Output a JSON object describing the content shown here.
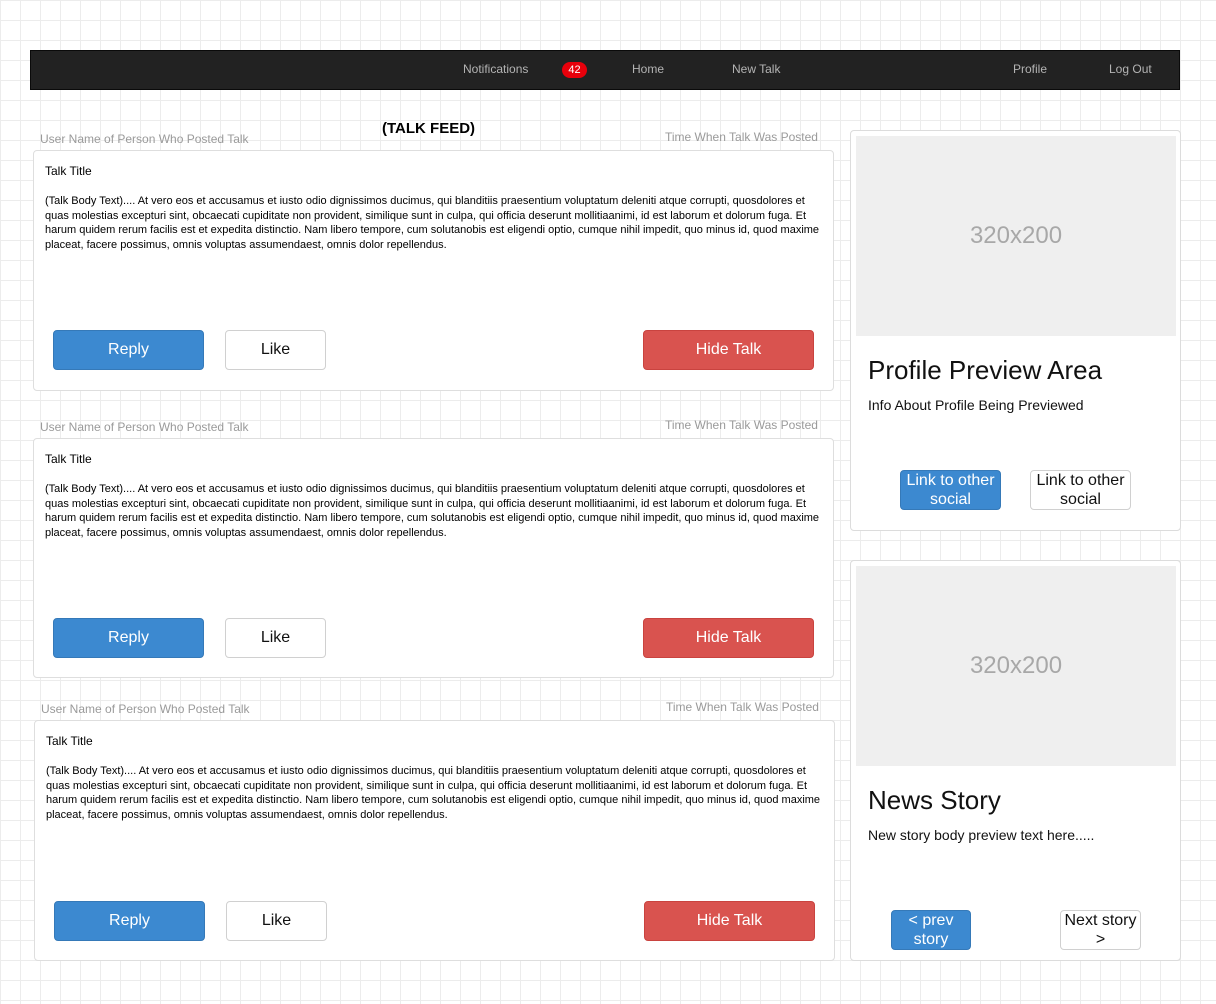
{
  "nav": {
    "notifications": "Notifications",
    "badge": "42",
    "home": "Home",
    "new_talk": "New Talk",
    "profile": "Profile",
    "logout": "Log Out"
  },
  "feed": {
    "title": "(TALK FEED)",
    "talks": [
      {
        "user": "User Name of Person Who Posted Talk",
        "time": "Time When Talk Was Posted",
        "title": "Talk Title",
        "body": "(Talk Body Text).... At vero eos et accusamus et iusto odio dignissimos ducimus, qui blanditiis praesentium voluptatum deleniti atque corrupti, quosdolores et quas molestias excepturi sint, obcaecati cupiditate non provident, similique sunt in culpa, qui officia deserunt mollitiaanimi, id est laborum et dolorum fuga. Et harum quidem rerum facilis est et expedita distinctio. Nam libero tempore, cum solutanobis est eligendi optio, cumque nihil impedit, quo minus id, quod maxime placeat, facere possimus, omnis voluptas assumendaest, omnis dolor repellendus.",
        "reply": "Reply",
        "like": "Like",
        "hide": "Hide Talk"
      },
      {
        "user": "User Name of Person Who Posted Talk",
        "time": "Time When Talk Was Posted",
        "title": "Talk Title",
        "body": "(Talk Body Text).... At vero eos et accusamus et iusto odio dignissimos ducimus, qui blanditiis praesentium voluptatum deleniti atque corrupti, quosdolores et quas molestias excepturi sint, obcaecati cupiditate non provident, similique sunt in culpa, qui officia deserunt mollitiaanimi, id est laborum et dolorum fuga. Et harum quidem rerum facilis est et expedita distinctio. Nam libero tempore, cum solutanobis est eligendi optio, cumque nihil impedit, quo minus id, quod maxime placeat, facere possimus, omnis voluptas assumendaest, omnis dolor repellendus.",
        "reply": "Reply",
        "like": "Like",
        "hide": "Hide Talk"
      },
      {
        "user": "User Name of Person Who Posted Talk",
        "time": "Time When Talk Was Posted",
        "title": "Talk Title",
        "body": "(Talk Body Text).... At vero eos et accusamus et iusto odio dignissimos ducimus, qui blanditiis praesentium voluptatum deleniti atque corrupti, quosdolores et quas molestias excepturi sint, obcaecati cupiditate non provident, similique sunt in culpa, qui officia deserunt mollitiaanimi, id est laborum et dolorum fuga. Et harum quidem rerum facilis est et expedita distinctio. Nam libero tempore, cum solutanobis est eligendi optio, cumque nihil impedit, quo minus id, quod maxime placeat, facere possimus, omnis voluptas assumendaest, omnis dolor repellendus.",
        "reply": "Reply",
        "like": "Like",
        "hide": "Hide Talk"
      }
    ]
  },
  "profile": {
    "image": "320x200",
    "heading": "Profile Preview Area",
    "info": "Info About Profile Being Previewed",
    "link1": "Link to other social",
    "link2": "Link to other social"
  },
  "news": {
    "image": "320x200",
    "heading": "News Story",
    "body": "New story body preview text here.....",
    "prev": "< prev story",
    "next": "Next story >"
  },
  "colors": {
    "navbar": "#222222",
    "badge": "#e8000b",
    "primary": "#3c89d0",
    "danger": "#d9534f"
  }
}
